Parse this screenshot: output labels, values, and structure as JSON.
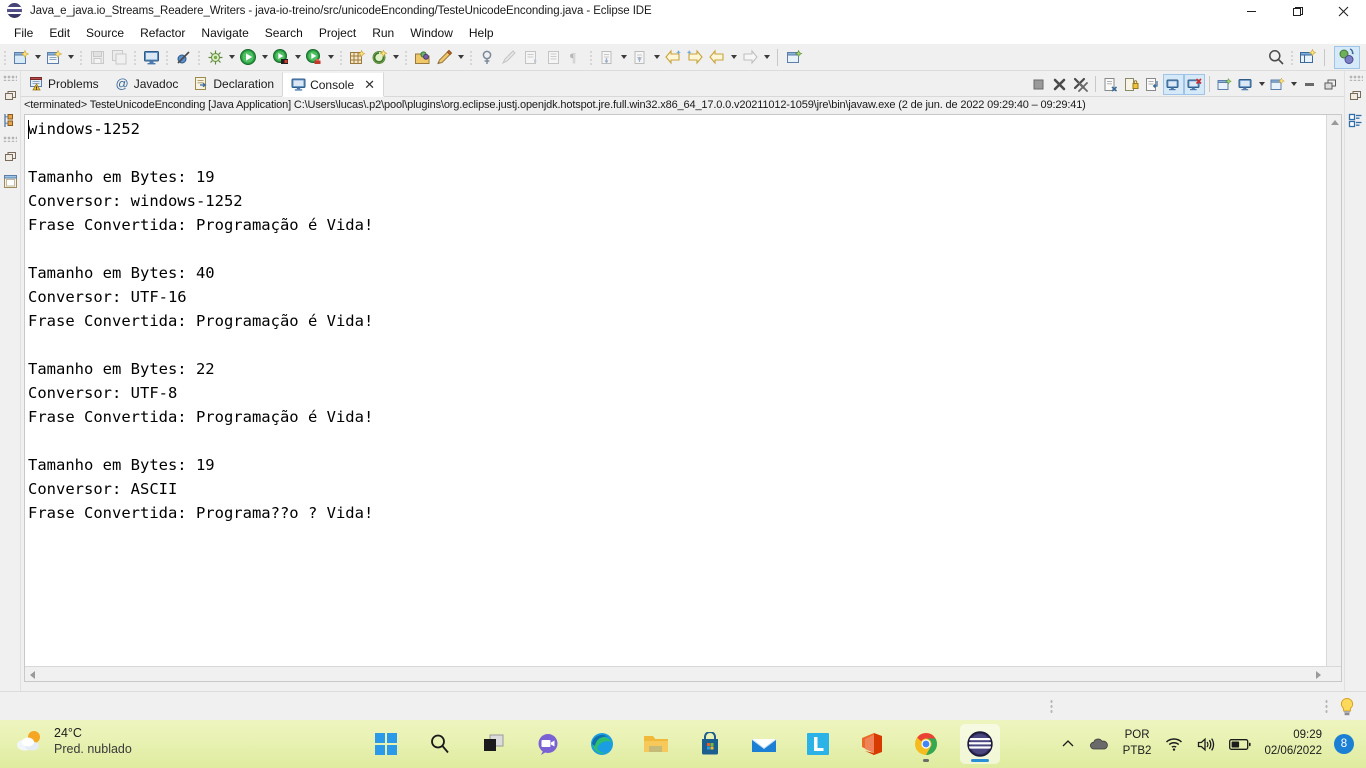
{
  "window": {
    "title": "Java_e_java.io_Streams_Readere_Writers - java-io-treino/src/unicodeEnconding/TesteUnicodeEnconding.java - Eclipse IDE",
    "app_icon": "eclipse-icon",
    "minimize_label": "—",
    "maximize_label": "❐",
    "close_label": "✕"
  },
  "menubar": {
    "items": [
      {
        "label": "File"
      },
      {
        "label": "Edit"
      },
      {
        "label": "Source"
      },
      {
        "label": "Refactor"
      },
      {
        "label": "Navigate"
      },
      {
        "label": "Search"
      },
      {
        "label": "Project"
      },
      {
        "label": "Run"
      },
      {
        "label": "Window"
      },
      {
        "label": "Help"
      }
    ]
  },
  "toolbar": {
    "items": [
      {
        "name": "new-wizard-icon"
      },
      {
        "name": "new-java-class-icon"
      },
      {
        "name": "save-icon"
      },
      {
        "name": "save-all-icon"
      },
      {
        "name": "open-console-icon"
      },
      {
        "name": "skip-breakpoints-icon"
      },
      {
        "name": "debug-icon"
      },
      {
        "name": "run-icon"
      },
      {
        "name": "run-last-tool-icon"
      },
      {
        "name": "coverage-icon"
      },
      {
        "name": "new-package-icon"
      },
      {
        "name": "open-type-icon"
      },
      {
        "name": "open-task-icon"
      },
      {
        "name": "edit-icon"
      },
      {
        "name": "search-scope-icon"
      },
      {
        "name": "toggle-mark-occurrences-icon"
      },
      {
        "name": "next-annotation-icon"
      },
      {
        "name": "previous-annotation-icon"
      },
      {
        "name": "pilcrow-icon"
      },
      {
        "name": "next-edit-icon"
      },
      {
        "name": "previous-edit-icon"
      },
      {
        "name": "back-to-icon"
      },
      {
        "name": "forward-to-icon"
      },
      {
        "name": "back-icon"
      },
      {
        "name": "forward-icon"
      },
      {
        "name": "new-window-icon"
      }
    ],
    "search_icon": "search-icon",
    "open-perspective-icon": "open-perspective-icon",
    "java-perspective-icon": "java-perspective-icon"
  },
  "left_rail": {
    "items": [
      {
        "name": "restore-icon"
      },
      {
        "name": "package-explorer-icon"
      },
      {
        "name": "restore-2-icon"
      },
      {
        "name": "outline-icon"
      }
    ]
  },
  "right_rail": {
    "items": [
      {
        "name": "restore-icon"
      },
      {
        "name": "task-list-icon"
      }
    ]
  },
  "view_tabs": [
    {
      "label": "Problems",
      "icon": "problems-icon",
      "active": false
    },
    {
      "label": "Javadoc",
      "icon": "javadoc-icon",
      "active": false
    },
    {
      "label": "Declaration",
      "icon": "declaration-icon",
      "active": false
    },
    {
      "label": "Console",
      "icon": "console-icon",
      "active": true,
      "close": "✕"
    }
  ],
  "view_toolbar": {
    "items": [
      {
        "name": "terminate-icon",
        "selected": false
      },
      {
        "name": "remove-launch-icon",
        "selected": false
      },
      {
        "name": "remove-all-terminated-icon",
        "selected": false
      },
      {
        "name": "clear-console-icon",
        "selected": false
      },
      {
        "name": "scroll-lock-icon",
        "selected": false
      },
      {
        "name": "word-wrap-icon",
        "selected": false
      },
      {
        "name": "show-console-on-output-icon",
        "selected": true
      },
      {
        "name": "show-console-on-error-icon",
        "selected": true
      },
      {
        "name": "pin-console-icon",
        "selected": false
      },
      {
        "name": "display-selected-console-icon",
        "selected": false
      },
      {
        "name": "open-console-icon",
        "selected": false
      },
      {
        "name": "minimize-icon",
        "selected": false
      },
      {
        "name": "maximize-icon",
        "selected": false
      }
    ]
  },
  "console": {
    "status_line": "<terminated> TesteUnicodeEnconding [Java Application] C:\\Users\\lucas\\.p2\\pool\\plugins\\org.eclipse.justj.openjdk.hotspot.jre.full.win32.x86_64_17.0.0.v20211012-1059\\jre\\bin\\javaw.exe  (2 de jun. de 2022 09:29:40 – 09:29:41)",
    "output": "windows-1252\n\nTamanho em Bytes: 19\nConversor: windows-1252\nFrase Convertida: Programação é Vida!\n\nTamanho em Bytes: 40\nConversor: UTF-16\nFrase Convertida: Programação é Vida!\n\nTamanho em Bytes: 22\nConversor: UTF-8\nFrase Convertida: Programação é Vida!\n\nTamanho em Bytes: 19\nConversor: ASCII\nFrase Convertida: Programa??o ? Vida!",
    "blocks": [
      {
        "header": "windows-1252"
      },
      {
        "bytes_label": "Tamanho em Bytes:",
        "bytes": "19",
        "converter_label": "Conversor:",
        "converter": "windows-1252",
        "phrase_label": "Frase Convertida:",
        "phrase": "Programação é Vida!"
      },
      {
        "bytes_label": "Tamanho em Bytes:",
        "bytes": "40",
        "converter_label": "Conversor:",
        "converter": "UTF-16",
        "phrase_label": "Frase Convertida:",
        "phrase": "Programação é Vida!"
      },
      {
        "bytes_label": "Tamanho em Bytes:",
        "bytes": "22",
        "converter_label": "Conversor:",
        "converter": "UTF-8",
        "phrase_label": "Frase Convertida:",
        "phrase": "Programação é Vida!"
      },
      {
        "bytes_label": "Tamanho em Bytes:",
        "bytes": "19",
        "converter_label": "Conversor:",
        "converter": "ASCII",
        "phrase_label": "Frase Convertida:",
        "phrase": "Programa??o ? Vida!"
      }
    ]
  },
  "statusbar": {
    "hint_icon": "light-bulb-icon"
  },
  "taskbar": {
    "weather": {
      "icon": "partly-cloudy-icon",
      "temperature": "24°C",
      "description": "Pred. nublado"
    },
    "apps": [
      {
        "name": "start-button",
        "icon": "windows-logo-icon",
        "active": false
      },
      {
        "name": "search-button",
        "icon": "search-icon",
        "active": false
      },
      {
        "name": "task-view-button",
        "icon": "task-view-icon",
        "active": false
      },
      {
        "name": "chat-button",
        "icon": "chat-icon",
        "active": false
      },
      {
        "name": "edge-button",
        "icon": "edge-icon",
        "active": false
      },
      {
        "name": "file-explorer-button",
        "icon": "folder-icon",
        "active": false
      },
      {
        "name": "microsoft-store-button",
        "icon": "store-icon",
        "active": false
      },
      {
        "name": "mail-button",
        "icon": "mail-icon",
        "active": false
      },
      {
        "name": "linkedin-button",
        "icon": "linkedin-icon",
        "active": false
      },
      {
        "name": "office-button",
        "icon": "office-icon",
        "active": false
      },
      {
        "name": "chrome-button",
        "icon": "chrome-icon",
        "active": false
      },
      {
        "name": "eclipse-button",
        "icon": "eclipse-icon",
        "active": true
      }
    ],
    "tray": {
      "overflow_icon": "chevron-up-icon",
      "cloud_icon": "onedrive-icon",
      "language_line1": "POR",
      "language_line2": "PTB2",
      "wifi_icon": "wifi-icon",
      "volume_icon": "volume-icon",
      "battery_icon": "battery-icon",
      "time": "09:29",
      "date": "02/06/2022",
      "notification_count": "8"
    }
  },
  "colors": {
    "accent_blue": "#1b7fd4",
    "taskbar_green": "#e5efab",
    "toolbar_gray": "#f0f0f0",
    "console_bg": "#ffffff",
    "selected_tool": "#d6e9f8"
  }
}
